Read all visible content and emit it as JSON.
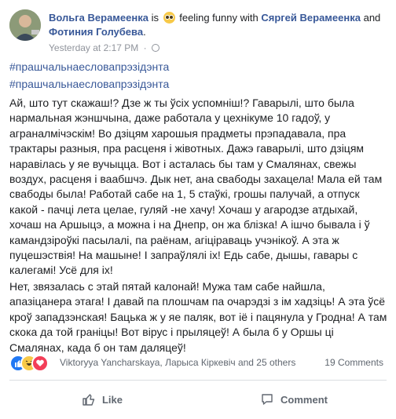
{
  "post": {
    "author": "Вольга Верамеенка",
    "is_text": "is",
    "feeling": "feeling funny",
    "with_text": "with",
    "tagged_1": "Сяргей Верамеенка",
    "and_text": "and",
    "tagged_2": "Фотиния Голубева",
    "period": ".",
    "timestamp": "Yesterday at 2:17 PM",
    "dot": "·",
    "privacy_icon": "globe-icon",
    "hashtag_1": "#прашчальнаесловапрэзідэнта",
    "hashtag_2": "#прашчальнаесловапрэзідэнта",
    "paragraph_1": "Ай, што тут скажаш!? Дзе ж ты ўсіх успомніш!? Гаварылі, што была нармальная жэншчына, даже работала у цехнікуме 10 гадоў, у аграналмічэскім! Во дзіцям харошыя прадметы прэпадавала, пра трактары разныя, пра расценя і жівотных. Дажэ гаварылі, што дзіцям наравілась у яе вучыцца. Вот і асталась бы там у Смалянах, свежы воздух, расценя і ваабшчэ. Дык нет, ана свабоды захацела! Мала ей там свабоды была! Работай сабе на 1, 5 стаўкі, грошы палучай, а отпуск какой - пачці лета целае, гуляй -не хачу! Хочаш у агародзе атдыхай, хочаш на Аршыцэ, а можна і на Днепр, он жа блізка! А ішчо бывала і ў камандзіроўкі пасылалі, па раёнам, агіціраваць учэнікоў. А эта ж пуцешэствія! На машыне! І запраўлялі іх! Едь сабе, дышы, гавары с калегамі! Усё для іх!",
    "paragraph_2": "Нет, звязалась с этай пятай калонай! Мужа там сабе найшла, апазіцанера этага! І давай па плошчам па очарэдзі з ім хадзіць! А эта ўсё кроў западзэнская! Бацька ж у яе паляк, вот іё і пацянула у Гродна! А там скока да той граніцы! Вот вірус і прыляцеў! А была б у Оршы ці Смалянах, када б он там даляцеў!"
  },
  "reactions": {
    "icons": [
      "like-icon",
      "haha-icon",
      "love-icon"
    ],
    "names_text": "Viktoryya Yancharskaya, Ларыса Кіркевіч and 25 others",
    "comments_text": "19 Comments"
  },
  "actions": {
    "like_label": "Like",
    "comment_label": "Comment"
  },
  "colors": {
    "link": "#385898",
    "text": "#1c1e21",
    "muted": "#90949c",
    "like_blue": "#2078f4",
    "love_red": "#f33e58",
    "haha_yellow": "#f7c948"
  }
}
